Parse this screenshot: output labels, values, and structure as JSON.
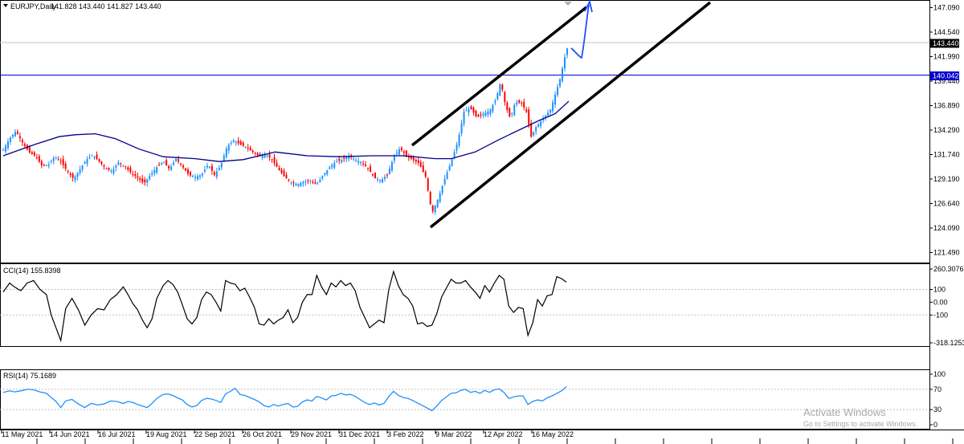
{
  "header": {
    "symbol_label": "EURJPY,Daily",
    "ohlc": "141.828 143.440 141.827 143.440",
    "menu_icon": "triangle-down-icon"
  },
  "price_labels": {
    "current": "143.440",
    "line": "140.042"
  },
  "cci": {
    "label": "CCI(14) 155.8398"
  },
  "rsi": {
    "label": "RSI(14) 75.1689"
  },
  "watermark": {
    "line1": "Activate Windows",
    "line2": "Go to Settings to activate Windows."
  },
  "colors": {
    "bull": "#1e90ff",
    "bear": "#ff0000",
    "ma": "#00008b",
    "hline": "#0000cd",
    "cci": "#000000",
    "rsi": "#1e90ff",
    "channel": "#000000",
    "arrow": "#1e50ff"
  },
  "chart_data": [
    {
      "type": "candlestick",
      "title": "EURJPY,Daily",
      "x_tick_labels": [
        "11 May 2021",
        "14 Jun 2021",
        "16 Jul 2021",
        "19 Aug 2021",
        "22 Sep 2021",
        "26 Oct 2021",
        "29 Nov 2021",
        "31 Dec 2021",
        "3 Feb 2022",
        "9 Mar 2022",
        "12 Apr 2022",
        "16 May 2022"
      ],
      "y_tick_labels": [
        "147.090",
        "144.540",
        "141.990",
        "139.440",
        "136.890",
        "134.290",
        "131.740",
        "129.190",
        "126.640",
        "124.090",
        "121.490"
      ],
      "ylim": [
        120.4,
        148.1
      ],
      "current_price": 143.44,
      "horizontal_line": 140.042,
      "close_anchors": [
        [
          0,
          132.2
        ],
        [
          8,
          133.4
        ],
        [
          16,
          134.2
        ],
        [
          24,
          133.0
        ],
        [
          32,
          132.0
        ],
        [
          40,
          131.6
        ],
        [
          48,
          130.6
        ],
        [
          56,
          130.6
        ],
        [
          64,
          131.5
        ],
        [
          72,
          131.0
        ],
        [
          80,
          130.0
        ],
        [
          88,
          129.2
        ],
        [
          96,
          130.2
        ],
        [
          104,
          131.2
        ],
        [
          112,
          131.7
        ],
        [
          120,
          131.0
        ],
        [
          128,
          130.3
        ],
        [
          136,
          130.0
        ],
        [
          144,
          130.9
        ],
        [
          152,
          130.5
        ],
        [
          160,
          129.8
        ],
        [
          168,
          129.3
        ],
        [
          176,
          128.7
        ],
        [
          184,
          129.6
        ],
        [
          192,
          130.4
        ],
        [
          200,
          131.0
        ],
        [
          208,
          130.2
        ],
        [
          216,
          131.3
        ],
        [
          224,
          130.5
        ],
        [
          232,
          129.6
        ],
        [
          240,
          129.4
        ],
        [
          248,
          129.6
        ],
        [
          256,
          130.7
        ],
        [
          264,
          129.6
        ],
        [
          272,
          130.6
        ],
        [
          280,
          132.6
        ],
        [
          288,
          133.2
        ],
        [
          296,
          132.8
        ],
        [
          304,
          132.5
        ],
        [
          312,
          132.0
        ],
        [
          320,
          131.6
        ],
        [
          328,
          131.8
        ],
        [
          336,
          131.2
        ],
        [
          344,
          130.2
        ],
        [
          352,
          129.4
        ],
        [
          360,
          128.8
        ],
        [
          368,
          128.6
        ],
        [
          376,
          128.9
        ],
        [
          384,
          129.0
        ],
        [
          392,
          128.6
        ],
        [
          400,
          129.6
        ],
        [
          408,
          130.4
        ],
        [
          416,
          131.0
        ],
        [
          424,
          131.2
        ],
        [
          432,
          131.6
        ],
        [
          440,
          131.2
        ],
        [
          448,
          130.9
        ],
        [
          456,
          130.3
        ],
        [
          464,
          129.3
        ],
        [
          472,
          129.0
        ],
        [
          480,
          129.6
        ],
        [
          488,
          131.4
        ],
        [
          496,
          132.4
        ],
        [
          504,
          131.6
        ],
        [
          512,
          131.2
        ],
        [
          520,
          130.8
        ],
        [
          528,
          129.4
        ],
        [
          536,
          125.6
        ],
        [
          544,
          127.2
        ],
        [
          552,
          129.2
        ],
        [
          560,
          131.0
        ],
        [
          568,
          133.0
        ],
        [
          576,
          136.2
        ],
        [
          584,
          136.6
        ],
        [
          592,
          135.6
        ],
        [
          600,
          136.0
        ],
        [
          608,
          136.3
        ],
        [
          616,
          137.5
        ],
        [
          622,
          139.4
        ],
        [
          628,
          136.8
        ],
        [
          634,
          135.5
        ],
        [
          640,
          137.2
        ],
        [
          648,
          137.1
        ],
        [
          654,
          136.2
        ],
        [
          660,
          133.6
        ],
        [
          666,
          134.6
        ],
        [
          672,
          135.2
        ],
        [
          678,
          135.8
        ],
        [
          684,
          136.4
        ],
        [
          690,
          138.0
        ],
        [
          696,
          139.6
        ],
        [
          702,
          141.9
        ],
        [
          707,
          143.44
        ]
      ],
      "moving_average_anchors": [
        [
          0,
          131.6
        ],
        [
          40,
          132.8
        ],
        [
          70,
          133.6
        ],
        [
          90,
          133.8
        ],
        [
          115,
          133.9
        ],
        [
          140,
          133.4
        ],
        [
          170,
          132.3
        ],
        [
          200,
          131.5
        ],
        [
          240,
          131.3
        ],
        [
          270,
          131.0
        ],
        [
          300,
          131.2
        ],
        [
          340,
          132.0
        ],
        [
          380,
          131.6
        ],
        [
          420,
          131.5
        ],
        [
          460,
          131.6
        ],
        [
          500,
          131.6
        ],
        [
          540,
          131.3
        ],
        [
          560,
          131.3
        ],
        [
          590,
          132.0
        ],
        [
          620,
          133.3
        ],
        [
          650,
          134.5
        ],
        [
          670,
          135.3
        ],
        [
          690,
          136.0
        ],
        [
          707,
          137.3
        ]
      ]
    },
    {
      "type": "line",
      "title": "CCI(14) 155.8398",
      "y_tick_labels": [
        "260.3076",
        "100",
        "0.00",
        "-100",
        "-318.1253"
      ],
      "ylim": [
        -318.1253,
        260.3076
      ],
      "values_anchors": [
        [
          0,
          80
        ],
        [
          8,
          150
        ],
        [
          14,
          120
        ],
        [
          22,
          90
        ],
        [
          30,
          150
        ],
        [
          38,
          170
        ],
        [
          46,
          100
        ],
        [
          54,
          60
        ],
        [
          60,
          -100
        ],
        [
          66,
          -200
        ],
        [
          72,
          -300
        ],
        [
          78,
          -50
        ],
        [
          86,
          30
        ],
        [
          94,
          -60
        ],
        [
          102,
          -180
        ],
        [
          110,
          -100
        ],
        [
          118,
          -50
        ],
        [
          126,
          -60
        ],
        [
          134,
          20
        ],
        [
          142,
          60
        ],
        [
          150,
          120
        ],
        [
          156,
          60
        ],
        [
          162,
          -10
        ],
        [
          168,
          -60
        ],
        [
          174,
          -140
        ],
        [
          180,
          -200
        ],
        [
          186,
          -130
        ],
        [
          192,
          30
        ],
        [
          200,
          130
        ],
        [
          206,
          170
        ],
        [
          212,
          140
        ],
        [
          218,
          80
        ],
        [
          224,
          -20
        ],
        [
          230,
          -130
        ],
        [
          236,
          -170
        ],
        [
          242,
          -120
        ],
        [
          248,
          20
        ],
        [
          254,
          80
        ],
        [
          260,
          60
        ],
        [
          266,
          0
        ],
        [
          272,
          -70
        ],
        [
          278,
          170
        ],
        [
          284,
          150
        ],
        [
          290,
          140
        ],
        [
          296,
          90
        ],
        [
          302,
          110
        ],
        [
          308,
          40
        ],
        [
          314,
          -40
        ],
        [
          320,
          -170
        ],
        [
          326,
          -180
        ],
        [
          332,
          -130
        ],
        [
          338,
          -170
        ],
        [
          344,
          -140
        ],
        [
          350,
          -120
        ],
        [
          356,
          -60
        ],
        [
          362,
          -160
        ],
        [
          368,
          -120
        ],
        [
          374,
          0
        ],
        [
          380,
          60
        ],
        [
          386,
          60
        ],
        [
          392,
          210
        ],
        [
          398,
          120
        ],
        [
          404,
          60
        ],
        [
          410,
          150
        ],
        [
          416,
          120
        ],
        [
          422,
          170
        ],
        [
          428,
          130
        ],
        [
          434,
          150
        ],
        [
          440,
          90
        ],
        [
          446,
          -40
        ],
        [
          452,
          -120
        ],
        [
          458,
          -200
        ],
        [
          464,
          -170
        ],
        [
          470,
          -140
        ],
        [
          476,
          -160
        ],
        [
          482,
          100
        ],
        [
          488,
          240
        ],
        [
          494,
          130
        ],
        [
          500,
          60
        ],
        [
          506,
          30
        ],
        [
          512,
          -30
        ],
        [
          518,
          -170
        ],
        [
          524,
          -160
        ],
        [
          530,
          -190
        ],
        [
          536,
          -180
        ],
        [
          542,
          -90
        ],
        [
          548,
          40
        ],
        [
          554,
          110
        ],
        [
          560,
          180
        ],
        [
          566,
          150
        ],
        [
          572,
          150
        ],
        [
          578,
          170
        ],
        [
          584,
          120
        ],
        [
          590,
          80
        ],
        [
          596,
          30
        ],
        [
          602,
          130
        ],
        [
          608,
          80
        ],
        [
          614,
          150
        ],
        [
          620,
          210
        ],
        [
          626,
          180
        ],
        [
          632,
          -30
        ],
        [
          638,
          -80
        ],
        [
          644,
          -40
        ],
        [
          650,
          -50
        ],
        [
          656,
          -260
        ],
        [
          662,
          -160
        ],
        [
          668,
          20
        ],
        [
          674,
          -30
        ],
        [
          680,
          50
        ],
        [
          686,
          60
        ],
        [
          692,
          200
        ],
        [
          698,
          185
        ],
        [
          704,
          157
        ]
      ]
    },
    {
      "type": "line",
      "title": "RSI(14) 75.1689",
      "y_tick_labels": [
        "100",
        "70",
        "30",
        "0"
      ],
      "ylim": [
        0,
        100
      ],
      "values_anchors": [
        [
          0,
          64
        ],
        [
          8,
          67
        ],
        [
          14,
          65
        ],
        [
          22,
          67
        ],
        [
          30,
          70
        ],
        [
          38,
          69
        ],
        [
          46,
          65
        ],
        [
          54,
          62
        ],
        [
          60,
          54
        ],
        [
          66,
          46
        ],
        [
          72,
          34
        ],
        [
          78,
          47
        ],
        [
          86,
          50
        ],
        [
          94,
          41
        ],
        [
          102,
          34
        ],
        [
          110,
          42
        ],
        [
          118,
          39
        ],
        [
          126,
          41
        ],
        [
          134,
          47
        ],
        [
          142,
          46
        ],
        [
          150,
          42
        ],
        [
          156,
          46
        ],
        [
          162,
          44
        ],
        [
          168,
          40
        ],
        [
          174,
          37
        ],
        [
          180,
          34
        ],
        [
          186,
          42
        ],
        [
          192,
          52
        ],
        [
          200,
          60
        ],
        [
          206,
          61
        ],
        [
          212,
          58
        ],
        [
          218,
          53
        ],
        [
          224,
          49
        ],
        [
          230,
          40
        ],
        [
          236,
          35
        ],
        [
          242,
          38
        ],
        [
          248,
          48
        ],
        [
          254,
          52
        ],
        [
          260,
          51
        ],
        [
          266,
          48
        ],
        [
          272,
          44
        ],
        [
          278,
          61
        ],
        [
          284,
          66
        ],
        [
          290,
          72
        ],
        [
          296,
          60
        ],
        [
          302,
          58
        ],
        [
          308,
          54
        ],
        [
          314,
          50
        ],
        [
          320,
          45
        ],
        [
          326,
          38
        ],
        [
          332,
          35
        ],
        [
          338,
          40
        ],
        [
          344,
          37
        ],
        [
          350,
          40
        ],
        [
          356,
          42
        ],
        [
          362,
          35
        ],
        [
          368,
          36
        ],
        [
          374,
          45
        ],
        [
          380,
          49
        ],
        [
          386,
          47
        ],
        [
          392,
          56
        ],
        [
          398,
          53
        ],
        [
          404,
          49
        ],
        [
          410,
          57
        ],
        [
          416,
          58
        ],
        [
          422,
          62
        ],
        [
          428,
          59
        ],
        [
          434,
          60
        ],
        [
          440,
          56
        ],
        [
          446,
          50
        ],
        [
          452,
          44
        ],
        [
          458,
          40
        ],
        [
          464,
          43
        ],
        [
          470,
          39
        ],
        [
          476,
          42
        ],
        [
          482,
          56
        ],
        [
          488,
          66
        ],
        [
          494,
          58
        ],
        [
          500,
          54
        ],
        [
          506,
          52
        ],
        [
          512,
          48
        ],
        [
          518,
          43
        ],
        [
          524,
          38
        ],
        [
          530,
          33
        ],
        [
          536,
          28
        ],
        [
          542,
          37
        ],
        [
          548,
          48
        ],
        [
          554,
          55
        ],
        [
          560,
          62
        ],
        [
          566,
          63
        ],
        [
          572,
          68
        ],
        [
          578,
          70
        ],
        [
          584,
          64
        ],
        [
          590,
          66
        ],
        [
          596,
          62
        ],
        [
          602,
          68
        ],
        [
          608,
          64
        ],
        [
          614,
          69
        ],
        [
          620,
          71
        ],
        [
          626,
          64
        ],
        [
          632,
          52
        ],
        [
          638,
          55
        ],
        [
          644,
          57
        ],
        [
          650,
          57
        ],
        [
          656,
          40
        ],
        [
          662,
          46
        ],
        [
          668,
          49
        ],
        [
          674,
          47
        ],
        [
          680,
          53
        ],
        [
          686,
          57
        ],
        [
          692,
          62
        ],
        [
          698,
          67
        ],
        [
          704,
          75.17
        ]
      ]
    }
  ]
}
